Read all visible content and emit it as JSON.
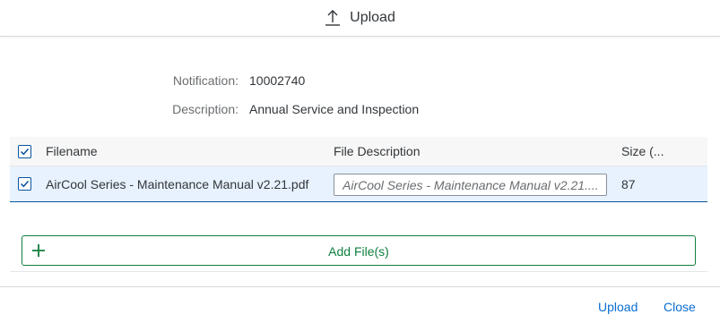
{
  "dialog": {
    "title": "Upload",
    "title_icon": "upload-icon"
  },
  "info": {
    "notification_label": "Notification:",
    "notification_value": "10002740",
    "description_label": "Description:",
    "description_value": "Annual Service and Inspection"
  },
  "table": {
    "select_all_checked": true,
    "columns": {
      "filename": "Filename",
      "file_description": "File Description",
      "size": "Size (..."
    },
    "rows": [
      {
        "checked": true,
        "filename": "AirCool Series - Maintenance Manual v2.21.pdf",
        "description_placeholder": "AirCool Series - Maintenance Manual v2.21....",
        "size": "87"
      }
    ]
  },
  "add_files": {
    "label": "Add File(s)",
    "icon": "plus-icon"
  },
  "footer": {
    "upload_label": "Upload",
    "close_label": "Close"
  },
  "colors": {
    "accent": "#0a6ed1",
    "positive": "#107e3e",
    "selected_row": "#e8f2ff"
  }
}
